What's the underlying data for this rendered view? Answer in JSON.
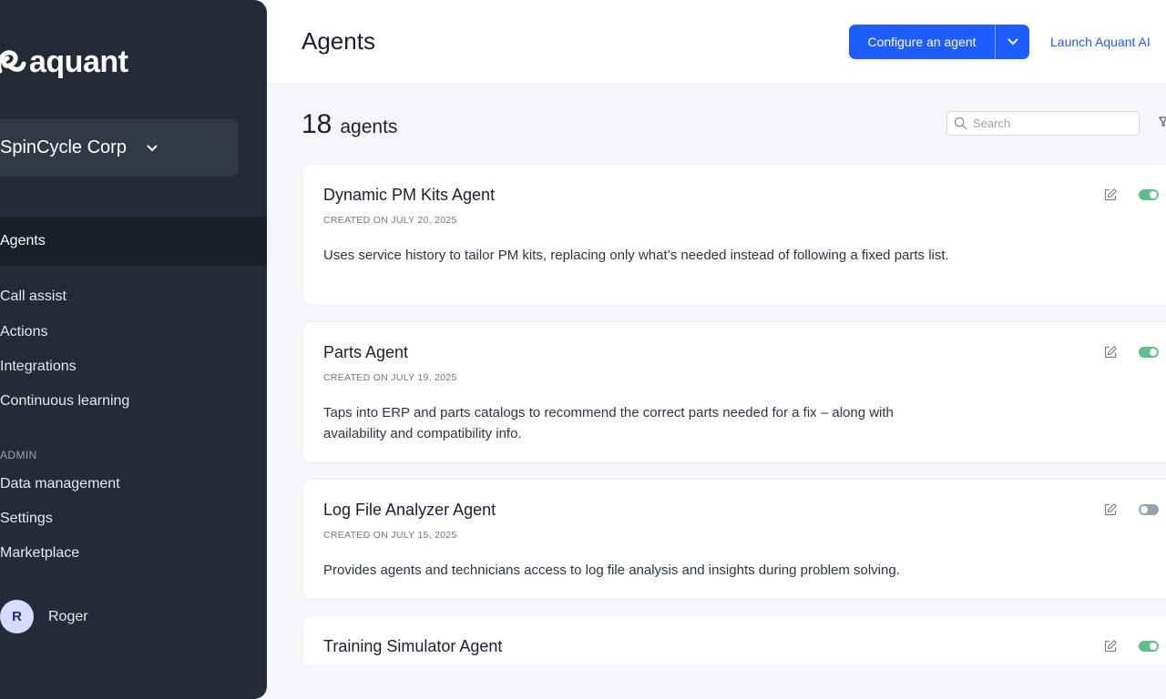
{
  "brand": {
    "name": "aquant"
  },
  "org": {
    "name": "SpinCycle Corp"
  },
  "nav": {
    "items": [
      "Agents",
      "Call assist",
      "Actions",
      "Integrations",
      "Continuous learning"
    ],
    "admin_label": "ADMIN",
    "admin_items": [
      "Data management",
      "Settings",
      "Marketplace"
    ]
  },
  "user": {
    "initial": "R",
    "name": "Roger"
  },
  "header": {
    "title": "Agents",
    "configure_label": "Configure an agent",
    "launch_label": "Launch Aquant AI"
  },
  "summary": {
    "count": "18",
    "count_label": "agents"
  },
  "search": {
    "placeholder": "Search"
  },
  "agents": [
    {
      "name": "Dynamic PM Kits Agent",
      "created": "CREATED ON JULY 20, 2025",
      "description": "Uses service history to tailor PM kits, replacing only what’s needed instead of following a fixed parts list.",
      "enabled": true
    },
    {
      "name": "Parts Agent",
      "created": "CREATED ON JULY 19, 2025",
      "description": "Taps into ERP and parts catalogs to recommend the correct parts needed for a fix – along with availability and compatibility info.",
      "enabled": true
    },
    {
      "name": "Log File Analyzer Agent",
      "created": "CREATED ON JULY 15, 2025",
      "description": "Provides agents and technicians access to log file analysis and insights during problem solving.",
      "enabled": false
    },
    {
      "name": "Training Simulator Agent",
      "created": "",
      "description": "",
      "enabled": true
    }
  ],
  "colors": {
    "sidebar": "#252a36",
    "accent": "#1d5cff",
    "toggle_on": "#5fc08a",
    "toggle_off": "#9aa0ac"
  },
  "icons": {
    "logo": "aquant-logo-icon",
    "org_dropdown": "chevron-down-icon",
    "configure_dropdown": "chevron-down-icon",
    "search": "search-icon",
    "filter": "filter-icon",
    "edit": "edit-icon",
    "toggle": "toggle-switch"
  }
}
